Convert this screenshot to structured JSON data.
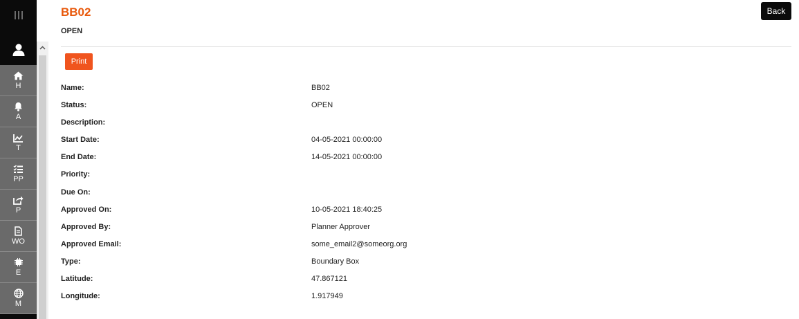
{
  "sidebar": {
    "items": [
      {
        "label": "H",
        "icon": "home-icon"
      },
      {
        "label": "A",
        "icon": "bell-icon"
      },
      {
        "label": "T",
        "icon": "chart-line-icon"
      },
      {
        "label": "PP",
        "icon": "list-check-icon"
      },
      {
        "label": "P",
        "icon": "share-icon"
      },
      {
        "label": "WO",
        "icon": "file-icon"
      },
      {
        "label": "E",
        "icon": "chip-icon"
      },
      {
        "label": "M",
        "icon": "globe-icon"
      }
    ]
  },
  "header": {
    "title": "BB02",
    "status": "OPEN",
    "back_label": "Back",
    "print_label": "Print"
  },
  "details": [
    {
      "label": "Name:",
      "value": "BB02"
    },
    {
      "label": "Status:",
      "value": "OPEN"
    },
    {
      "label": "Description:",
      "value": ""
    },
    {
      "label": "Start Date:",
      "value": "04-05-2021 00:00:00"
    },
    {
      "label": "End Date:",
      "value": "14-05-2021 00:00:00"
    },
    {
      "label": "Priority:",
      "value": ""
    },
    {
      "label": "Due On:",
      "value": ""
    },
    {
      "label": "Approved On:",
      "value": "10-05-2021 18:40:25"
    },
    {
      "label": "Approved By:",
      "value": "Planner Approver"
    },
    {
      "label": "Approved Email:",
      "value": "some_email2@someorg.org"
    },
    {
      "label": "Type:",
      "value": "Boundary Box"
    },
    {
      "label": "Latitude:",
      "value": "47.867121"
    },
    {
      "label": "Longitude:",
      "value": "1.917949"
    }
  ],
  "colors": {
    "accent": "#e8590c",
    "print_button": "#f0541e",
    "sidebar_bg": "#0b0b0b",
    "nav_item_bg": "#6a6a6a"
  }
}
